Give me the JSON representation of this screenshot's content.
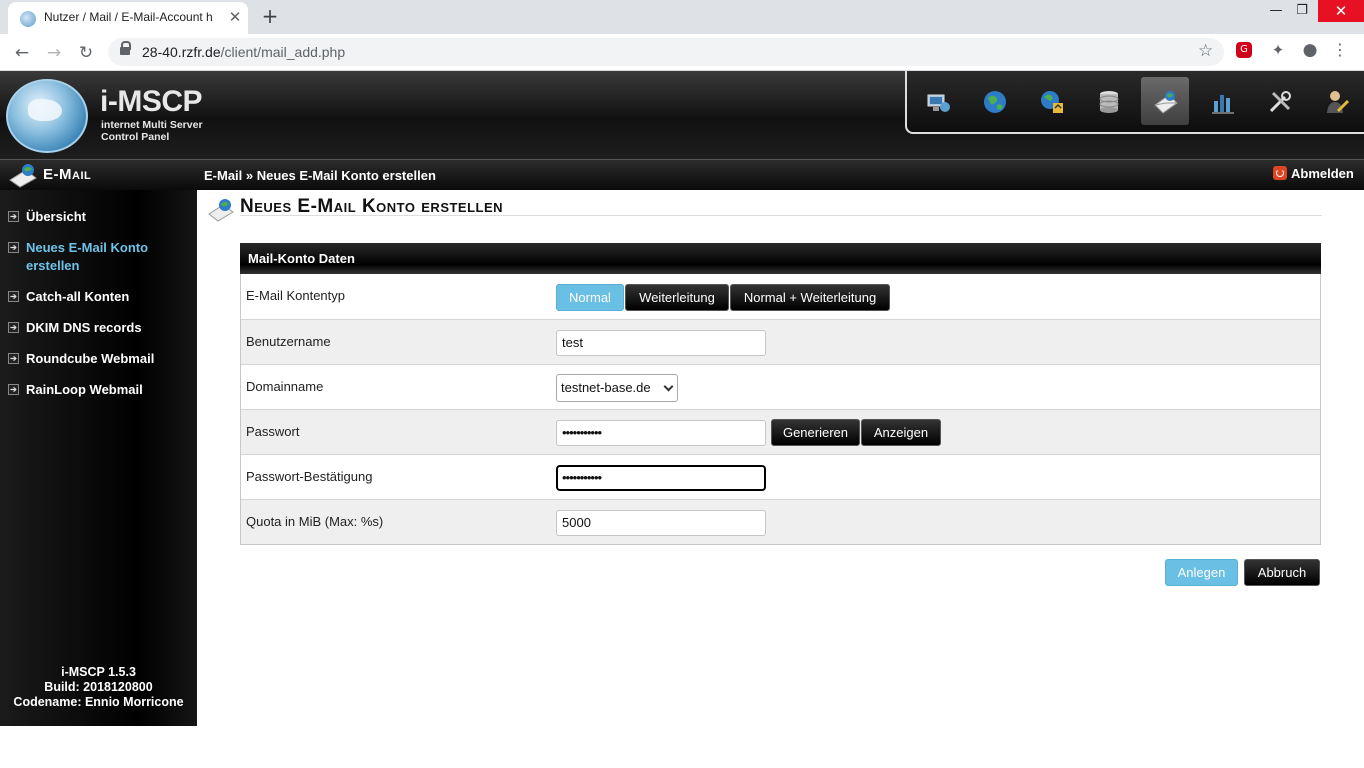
{
  "browser": {
    "tab_title": "Nutzer / Mail / E-Mail-Account h",
    "url_host": "28-40.rzfr.de",
    "url_path": "/client/mail_add.php",
    "window_controls": [
      "minimize-icon",
      "restore-icon",
      "close-icon"
    ]
  },
  "app": {
    "logo_title": "i-MSCP",
    "logo_subtitle_line1": "internet Multi Server",
    "logo_subtitle_line2": "Control Panel",
    "top_nav_icons": [
      "general-icon",
      "domains-icon",
      "ftp-icon",
      "databases-icon",
      "mail-icon",
      "statistics-icon",
      "tools-icon",
      "profile-icon"
    ],
    "top_nav_active": "mail-icon"
  },
  "titlebar": {
    "section": "E-Mail",
    "breadcrumb": "E-Mail » Neues E-Mail Konto erstellen",
    "logout": "Abmelden"
  },
  "sidebar": {
    "items": [
      {
        "label": "Übersicht"
      },
      {
        "label": "Neues E-Mail Konto erstellen"
      },
      {
        "label": "Catch-all Konten"
      },
      {
        "label": "DKIM DNS records"
      },
      {
        "label": "Roundcube Webmail"
      },
      {
        "label": "RainLoop Webmail"
      }
    ],
    "footer_version": "i-MSCP 1.5.3",
    "footer_build": "Build: 2018120800",
    "footer_codename": "Codename: Ennio Morricone"
  },
  "main": {
    "heading": "Neues E-Mail Konto erstellen",
    "panel_title": "Mail-Konto Daten",
    "rows": {
      "type_label": "E-Mail Kontentyp",
      "type_options": [
        "Normal",
        "Weiterleitung",
        "Normal + Weiterleitung"
      ],
      "type_selected": "Normal",
      "username_label": "Benutzername",
      "username_value": "test",
      "domain_label": "Domainname",
      "domain_value": "testnet-base.de",
      "password_label": "Passwort",
      "password_mask": "•••••••••••",
      "generate_label": "Generieren",
      "show_label": "Anzeigen",
      "confirm_label": "Passwort-Bestätigung",
      "confirm_mask": "•••••••••••",
      "quota_label": "Quota in MiB (Max: %s)",
      "quota_value": "5000"
    },
    "submit_label": "Anlegen",
    "cancel_label": "Abbruch"
  },
  "colors": {
    "accent": "#6ac0e4",
    "sidebar_active": "#6ec3e8",
    "logout_icon": "#dd4422"
  }
}
